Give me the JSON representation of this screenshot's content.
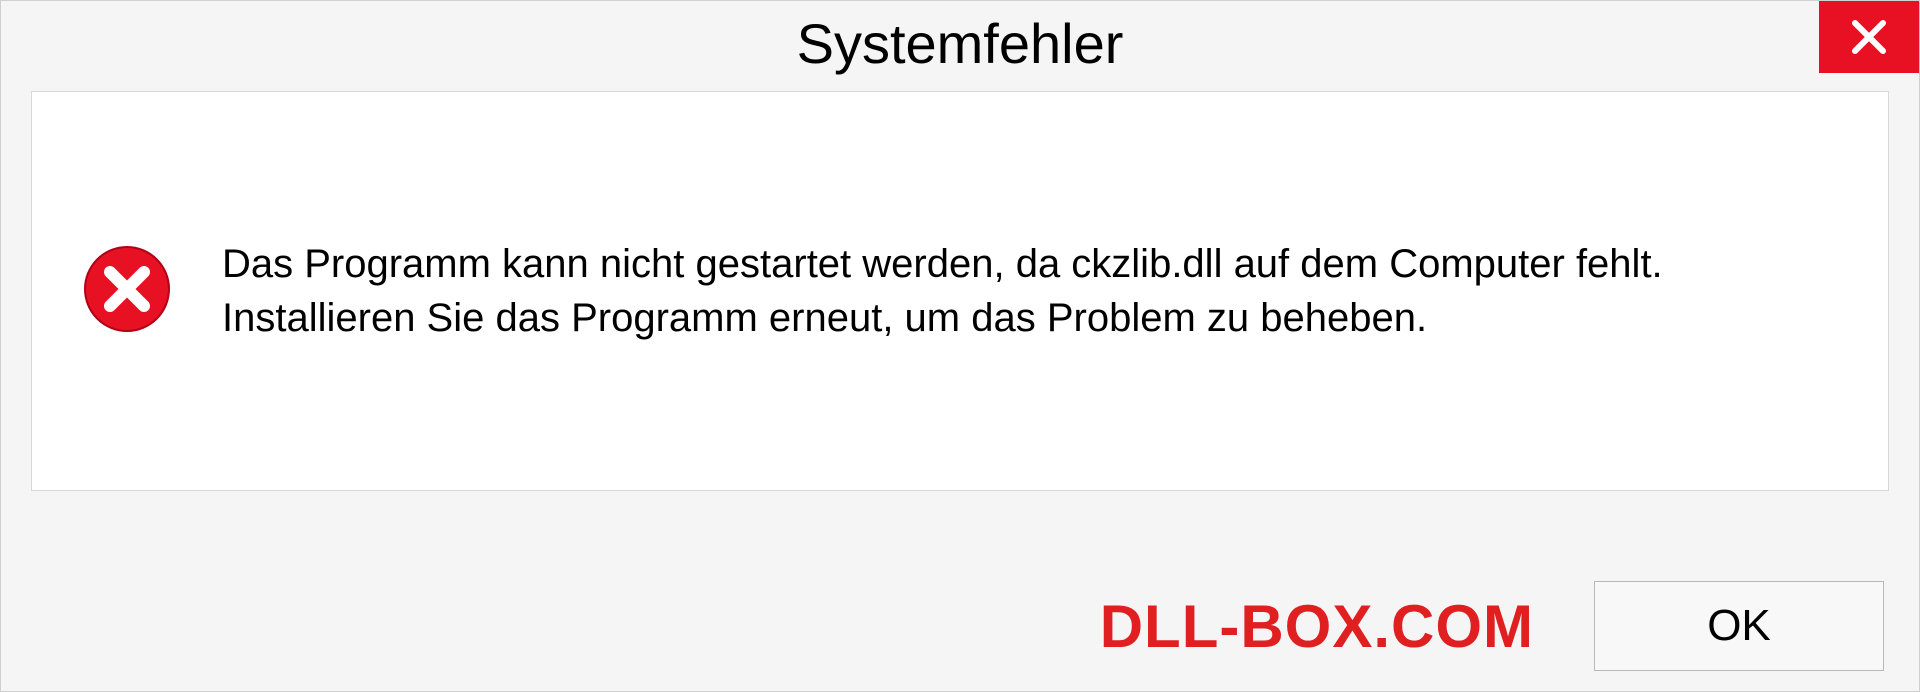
{
  "dialog": {
    "title": "Systemfehler",
    "message": "Das Programm kann nicht gestartet werden, da ckzlib.dll auf dem Computer fehlt. Installieren Sie das Programm erneut, um das Problem zu beheben.",
    "ok_label": "OK"
  },
  "watermark": "DLL-BOX.COM"
}
